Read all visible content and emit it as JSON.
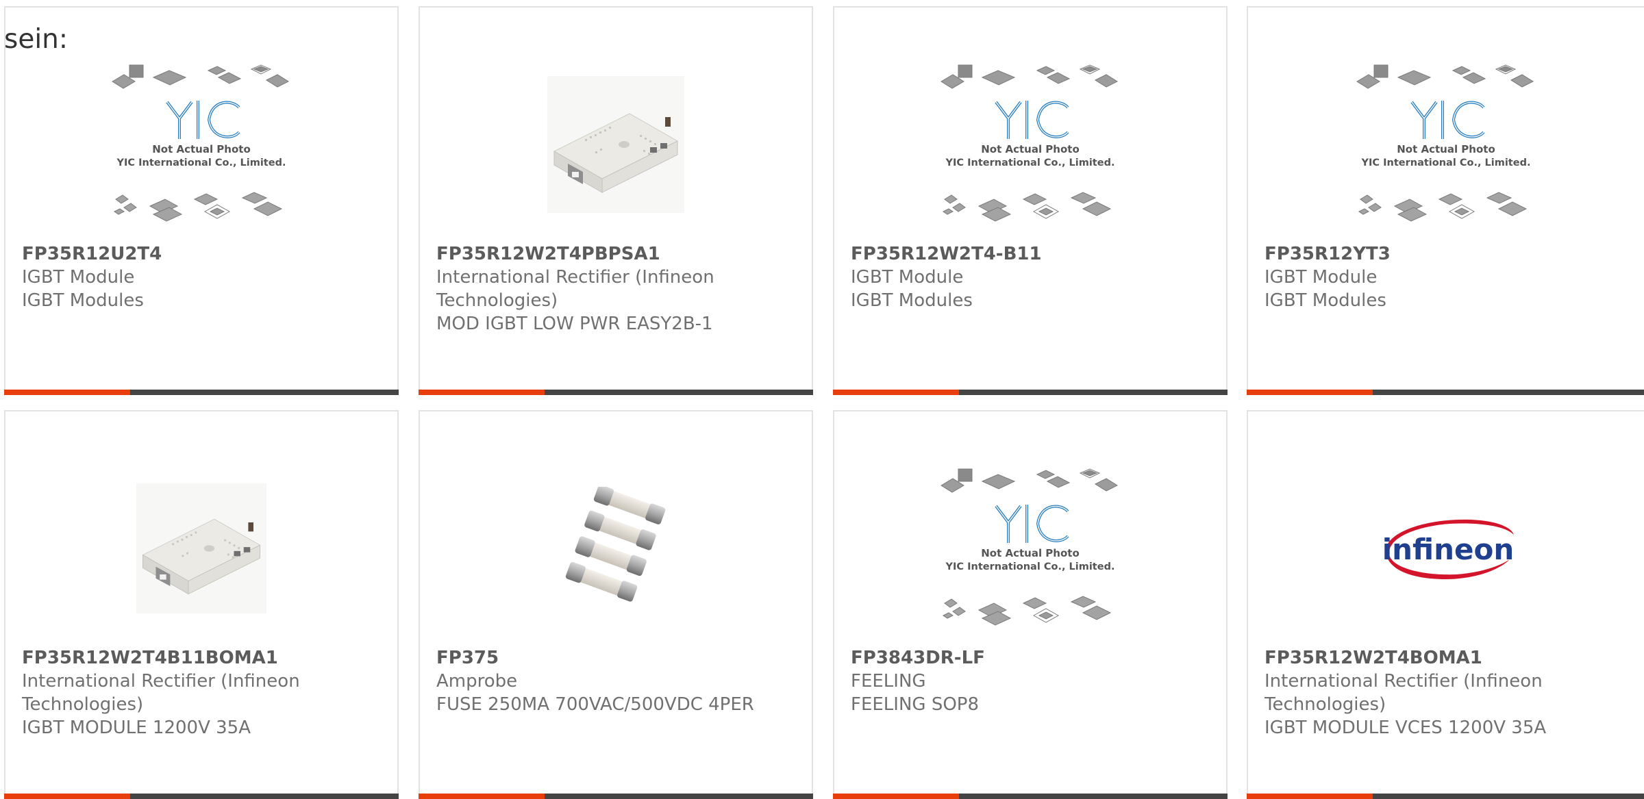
{
  "header": {
    "label": "sein:"
  },
  "brand": {
    "accent_color": "#e83e0b",
    "bar_color": "#444444",
    "placeholder_logo_text": "YIC",
    "placeholder_caption_line1": "Not Actual Photo",
    "placeholder_caption_line2": "YIC International Co., Limited.",
    "infineon_logo_text": "infineon"
  },
  "products": [
    {
      "part_number": "FP35R12U2T4",
      "manufacturer": "IGBT Module",
      "description": "IGBT Modules",
      "image": "yic-placeholder"
    },
    {
      "part_number": "FP35R12W2T4PBPSA1",
      "manufacturer": "International Rectifier (Infineon Technologies)",
      "description": "MOD IGBT LOW PWR EASY2B-1",
      "image": "igbt-module-photo"
    },
    {
      "part_number": "FP35R12W2T4-B11",
      "manufacturer": "IGBT Module",
      "description": "IGBT Modules",
      "image": "yic-placeholder"
    },
    {
      "part_number": "FP35R12YT3",
      "manufacturer": "IGBT Module",
      "description": "IGBT Modules",
      "image": "yic-placeholder"
    },
    {
      "part_number": "FP35R12W2T4B11BOMA1",
      "manufacturer": "International Rectifier (Infineon Technologies)",
      "description": "IGBT MODULE 1200V 35A",
      "image": "igbt-module-photo"
    },
    {
      "part_number": "FP375",
      "manufacturer": "Amprobe",
      "description": "FUSE 250MA 700VAC/500VDC 4PER",
      "image": "fuse-photo"
    },
    {
      "part_number": "FP3843DR-LF",
      "manufacturer": "FEELING",
      "description": "FEELING SOP8",
      "image": "yic-placeholder"
    },
    {
      "part_number": "FP35R12W2T4BOMA1",
      "manufacturer": "International Rectifier (Infineon Technologies)",
      "description": "IGBT MODULE VCES 1200V 35A",
      "image": "infineon-logo"
    }
  ]
}
